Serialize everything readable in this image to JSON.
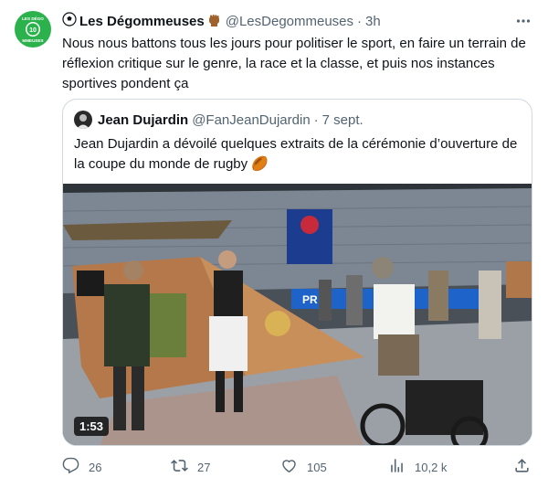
{
  "tweet": {
    "display_name": "Les Dégommeuses",
    "name_prefix_emoji": "soccer-ball-icon",
    "name_suffix_emoji": "raised-fist-icon",
    "handle": "@LesDegommeuses",
    "dot": "·",
    "time": "3h",
    "text": "Nous nous battons tous les jours pour politiser le sport, en faire un terrain de réflexion critique sur le genre, la race et la classe, et puis nos instances sportives pondent ça",
    "avatar_text_top": "LES DÉGOMMEUSES",
    "avatar_number": "10"
  },
  "quoted": {
    "display_name": "Jean Dujardin",
    "handle": "@FanJeanDujardin",
    "dot": "·",
    "time": "7 sept.",
    "text": "Jean Dujardin a dévoilé quelques extraits de la cérémonie d’ouverture de la coupe du monde de rugby 🏉",
    "video_duration": "1:53"
  },
  "actions": {
    "replies": "26",
    "retweets": "27",
    "likes": "105",
    "views": "10,2 k"
  },
  "colors": {
    "text": "#0f1419",
    "secondary": "#536471",
    "border": "#cfd9de",
    "avatar_green": "#2bb24c"
  }
}
